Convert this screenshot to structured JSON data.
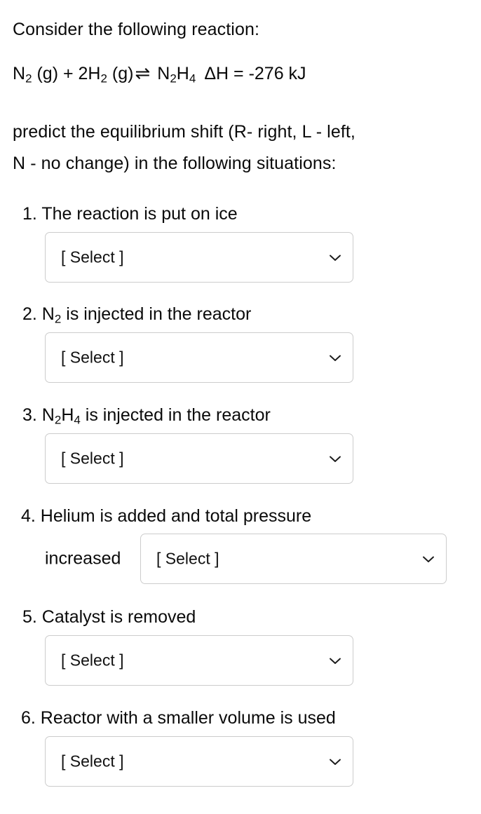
{
  "prompt": {
    "intro": "Consider the following reaction:",
    "equation": {
      "reactant_1": "N",
      "reactant_1_sub": "2",
      "reactant_1_state": " (g)",
      "plus": " + ",
      "reactant_2_coeff": "2H",
      "reactant_2_sub": "2",
      "reactant_2_state": " (g)",
      "arrow": "⇌",
      "product": "N",
      "product_sub_1": "2",
      "product_h": "H",
      "product_sub_2": "4",
      "enthalpy": "ΔH = -276 kJ",
      "plain_text": "N2 (g) + 2H2 (g) ⇌ N2H4  ΔH = -276 kJ"
    },
    "instruction_line_1": "predict the equilibrium shift (R- right, L - left,",
    "instruction_line_2": "N - no change) in the following situations:"
  },
  "select_placeholder": "[ Select ]",
  "chevron_icon": "chevron-down-icon",
  "items": [
    {
      "number": "1.",
      "label_plain": "1. The reaction is put on ice",
      "text_before": "1. The reaction is put on ice",
      "selected": "[ Select ]"
    },
    {
      "number": "2.",
      "label_plain": "2. N2 is injected in the reactor",
      "prefix": "2. N",
      "sub": "2",
      "suffix": " is injected in the reactor",
      "selected": "[ Select ]"
    },
    {
      "number": "3.",
      "label_plain": "3. N2H4 is injected in the reactor",
      "prefix": "3. N",
      "sub_1": "2",
      "mid": "H",
      "sub_2": "4",
      "suffix": "  is injected in the reactor",
      "selected": "[ Select ]"
    },
    {
      "number": "4.",
      "label_plain": "4. Helium is added and total pressure increased",
      "text_line_1": "4. Helium is added and total pressure",
      "text_line_2": "increased",
      "selected": "[ Select ]"
    },
    {
      "number": "5.",
      "label_plain": "5. Catalyst is removed",
      "text_before": "5. Catalyst is removed",
      "selected": "[ Select ]"
    },
    {
      "number": "6.",
      "label_plain": "6. Reactor with a smaller volume is used",
      "text_before": "6. Reactor with a smaller volume is used",
      "selected": "[ Select ]"
    }
  ],
  "colors": {
    "text": "#0a0a0a",
    "border": "#cccccc",
    "background": "#ffffff"
  }
}
